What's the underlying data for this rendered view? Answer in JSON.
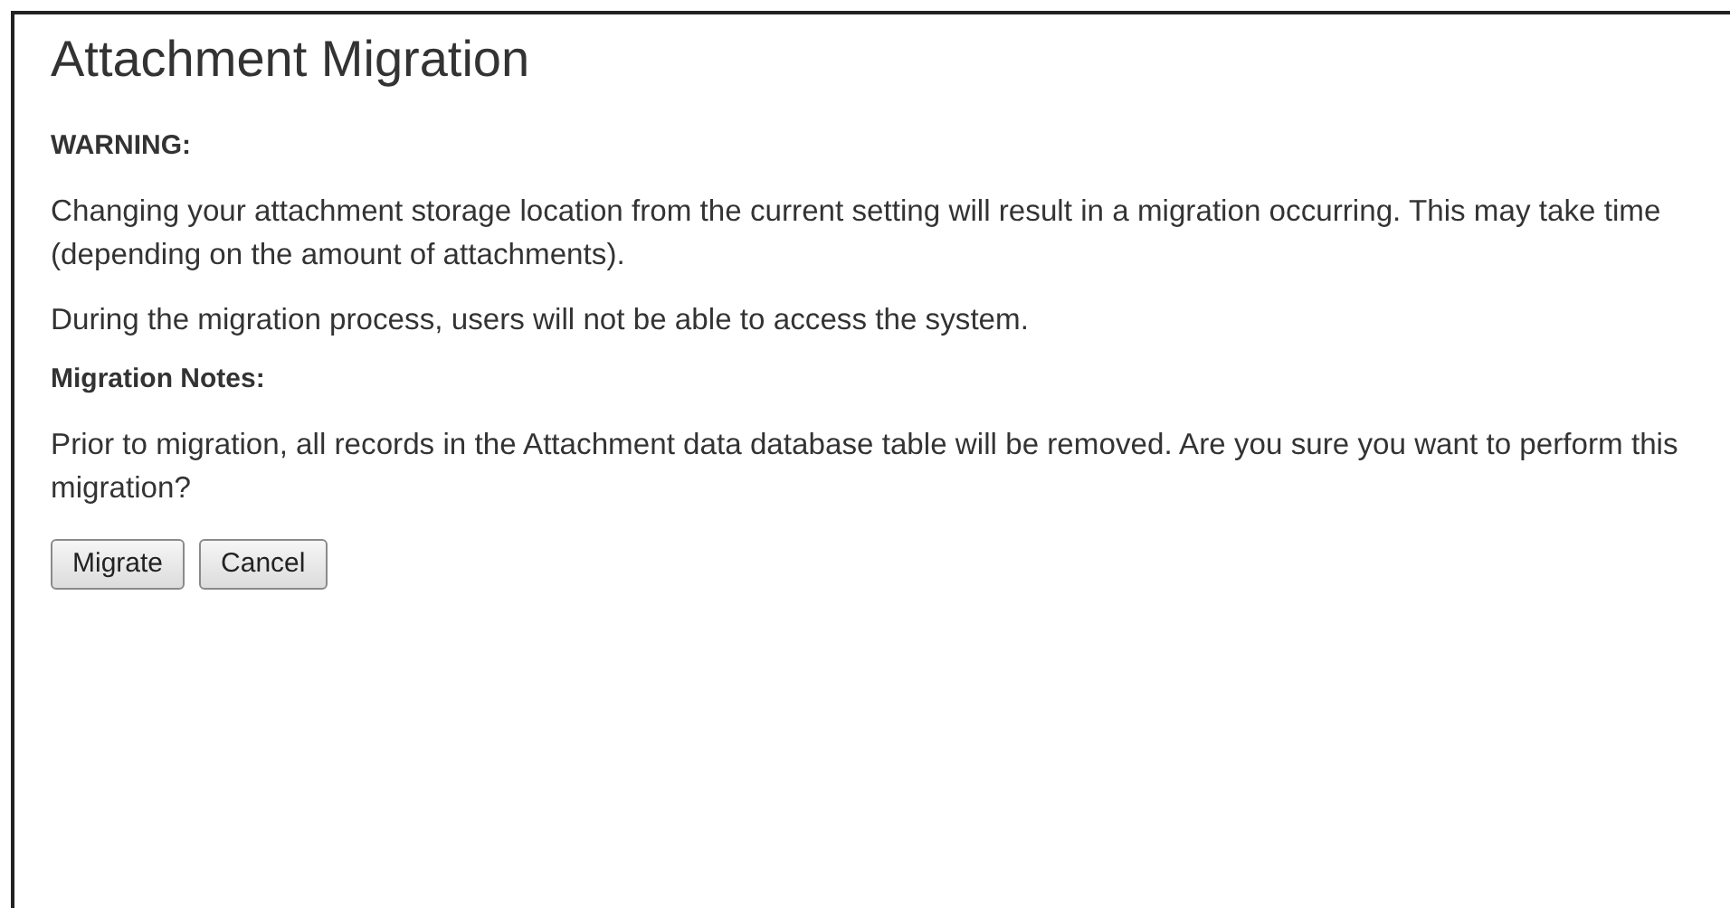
{
  "dialog": {
    "title": "Attachment Migration",
    "blocks": [
      {
        "kind": "heading",
        "text": "WARNING:"
      },
      {
        "kind": "paragraph",
        "text": "Changing your attachment storage location from the current setting will result in a migration occurring. This may take time (depending on the amount of attachments)."
      },
      {
        "kind": "paragraph",
        "text": "During the migration process, users will not be able to access the system."
      },
      {
        "kind": "heading",
        "text": "Migration Notes:"
      },
      {
        "kind": "paragraph",
        "text": "Prior to migration, all records in the Attachment data database table will be removed. Are you sure you want to perform this migration?"
      }
    ],
    "buttons": [
      "Migrate",
      "Cancel"
    ]
  }
}
